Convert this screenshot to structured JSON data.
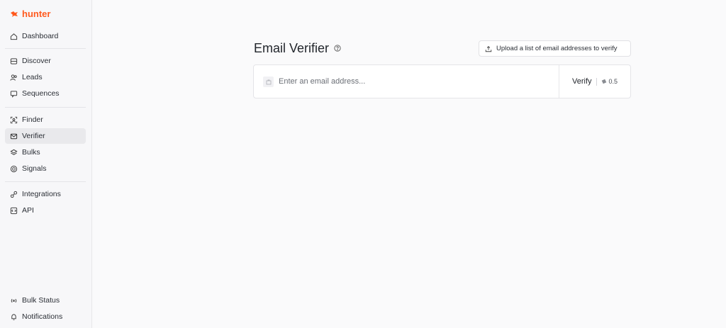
{
  "brand": {
    "name": "hunter",
    "accent": "#ff5a1f"
  },
  "sidebar": {
    "top_item": {
      "label": "Dashboard",
      "icon": "home-icon"
    },
    "group1": [
      {
        "label": "Discover",
        "icon": "database-icon"
      },
      {
        "label": "Leads",
        "icon": "users-icon"
      },
      {
        "label": "Sequences",
        "icon": "mail-chat-icon"
      }
    ],
    "group2": [
      {
        "label": "Finder",
        "icon": "scan-user-icon"
      },
      {
        "label": "Verifier",
        "icon": "mail-check-icon",
        "active": true
      },
      {
        "label": "Bulks",
        "icon": "layers-icon"
      },
      {
        "label": "Signals",
        "icon": "target-icon"
      }
    ],
    "group3": [
      {
        "label": "Integrations",
        "icon": "link-icon"
      },
      {
        "label": "API",
        "icon": "code-icon"
      }
    ],
    "bottom": [
      {
        "label": "Bulk Status",
        "icon": "broadcast-icon"
      },
      {
        "label": "Notifications",
        "icon": "bell-icon"
      }
    ]
  },
  "main": {
    "title": "Email Verifier",
    "upload_label": "Upload a list of email addresses to verify",
    "input_placeholder": "Enter an email address...",
    "verify_label": "Verify",
    "credit_cost": "0.5"
  }
}
